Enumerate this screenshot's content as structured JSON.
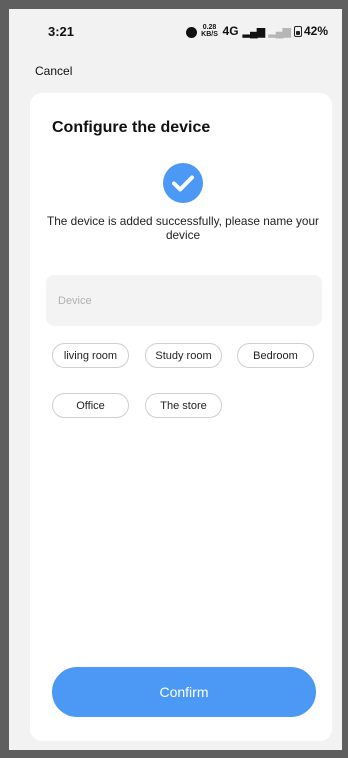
{
  "status_bar": {
    "time": "3:21",
    "network_speed_value": "0.28",
    "network_speed_unit": "KB/S",
    "network_type": "4G",
    "battery": "42%"
  },
  "header": {
    "cancel_label": "Cancel"
  },
  "card": {
    "title": "Configure the device",
    "message": "The device is added successfully, please name your device",
    "input_value": "",
    "input_placeholder": "Device",
    "chips": [
      {
        "label": "living room"
      },
      {
        "label": "Study room"
      },
      {
        "label": "Bedroom"
      },
      {
        "label": "Office"
      },
      {
        "label": "The store"
      }
    ],
    "confirm_label": "Confirm"
  },
  "colors": {
    "accent": "#4b98f5",
    "card_background": "#ffffff",
    "screen_background": "#f2f2f2",
    "outer_frame": "#5f5f5f"
  },
  "icons": {
    "alarm": "alarm-icon",
    "signal": "signal-icon",
    "battery": "battery-icon",
    "success": "check-circle-icon"
  }
}
